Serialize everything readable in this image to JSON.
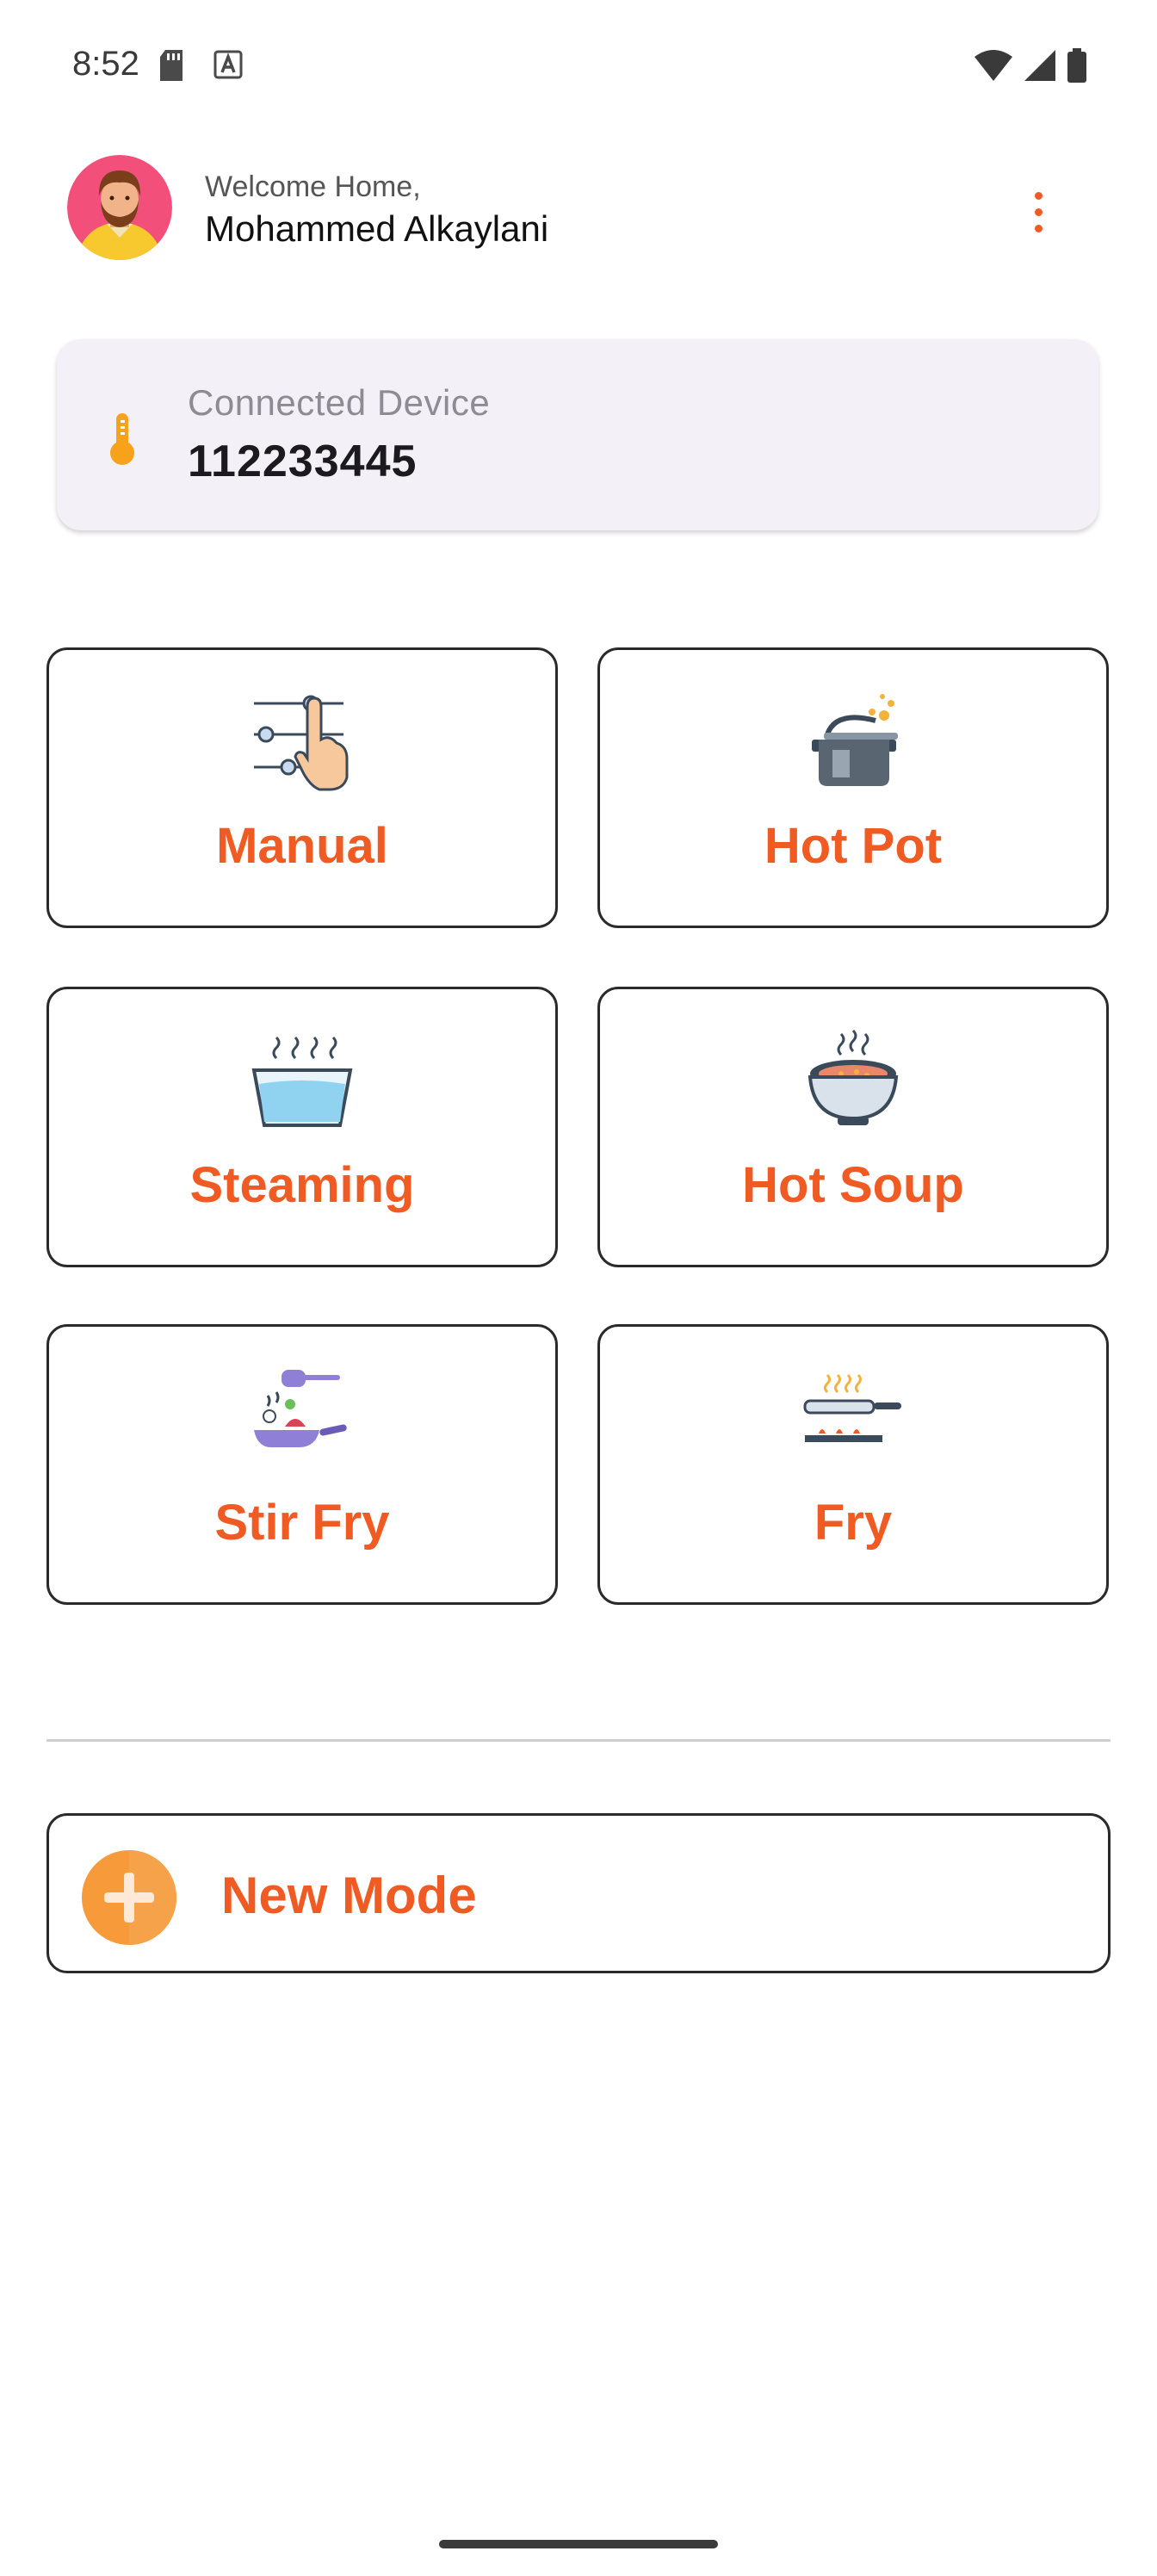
{
  "status_bar": {
    "time": "8:52",
    "icons_left": [
      "sd-card-icon",
      "text-a-icon"
    ],
    "icons_right": [
      "wifi-icon",
      "cellular-icon",
      "battery-icon"
    ]
  },
  "header": {
    "welcome": "Welcome Home,",
    "username": "Mohammed Alkaylani",
    "menu_icon": "more-vert-icon"
  },
  "device": {
    "label": "Connected Device",
    "id": "112233445",
    "icon": "thermometer-icon"
  },
  "modes": [
    {
      "label": "Manual",
      "icon": "manual-sliders-icon"
    },
    {
      "label": "Hot Pot",
      "icon": "hot-pot-icon"
    },
    {
      "label": "Steaming",
      "icon": "steaming-icon"
    },
    {
      "label": "Hot Soup",
      "icon": "hot-soup-icon"
    },
    {
      "label": "Stir Fry",
      "icon": "stir-fry-icon"
    },
    {
      "label": "Fry",
      "icon": "fry-pan-icon"
    }
  ],
  "new_mode": {
    "label": "New Mode",
    "icon": "plus-circle-icon"
  },
  "colors": {
    "accent": "#F05A23",
    "card_bg": "#F3F0F7",
    "border": "#2A2A2A"
  }
}
